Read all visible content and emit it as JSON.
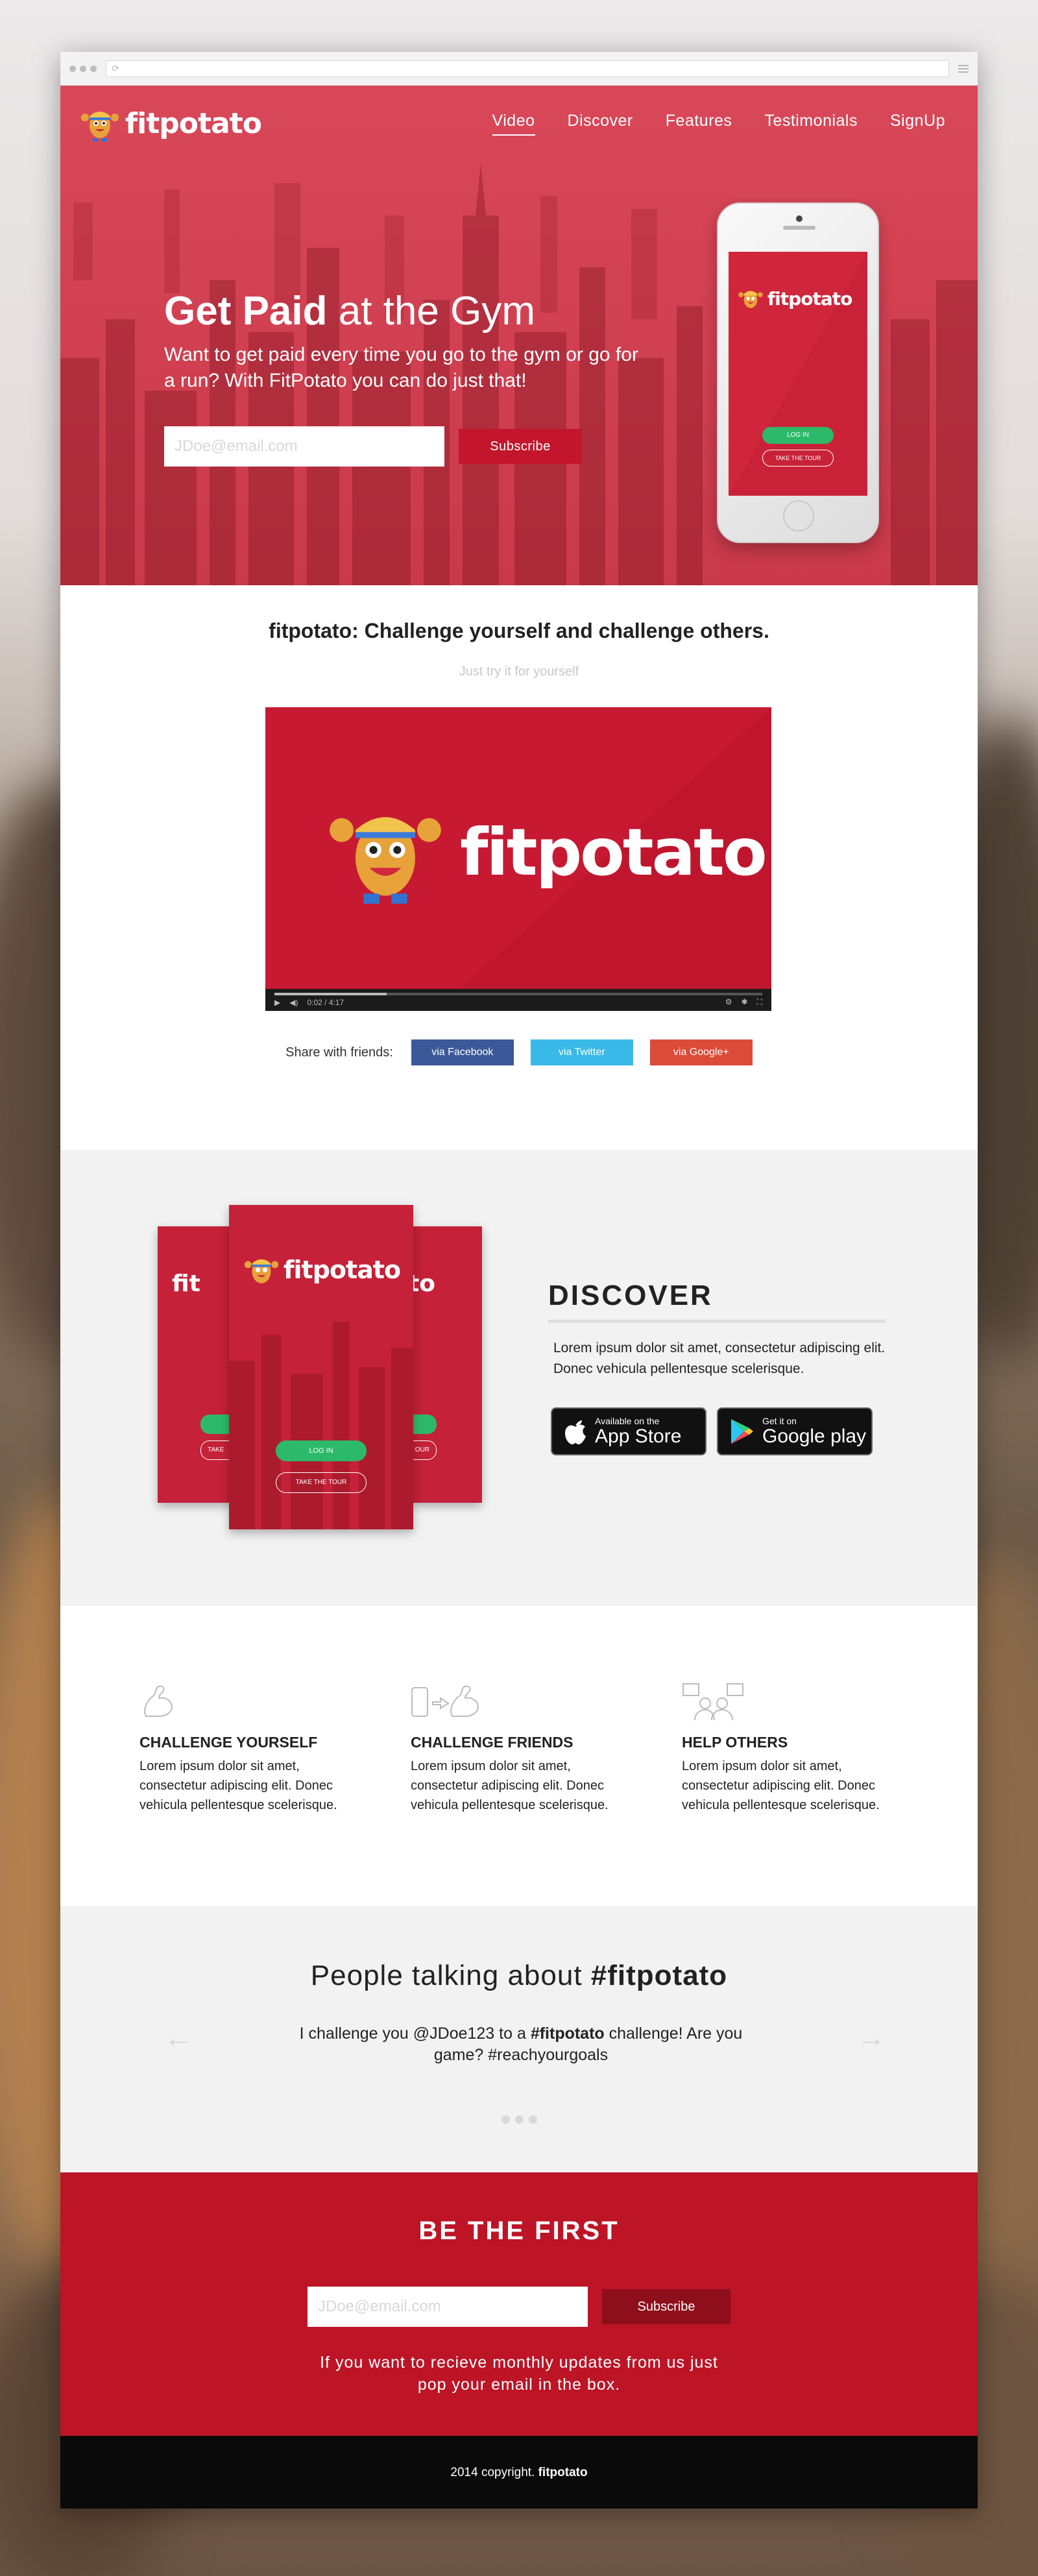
{
  "colors": {
    "brand_red": "#c3162c",
    "facebook": "#3b5998",
    "twitter": "#39b9e8",
    "google": "#dc4a38",
    "green": "#2db96a"
  },
  "browser": {
    "url": ""
  },
  "nav": {
    "brand": "fitpotato",
    "links": [
      "Video",
      "Discover",
      "Features",
      "Testimonials",
      "SignUp"
    ],
    "active": "Video"
  },
  "hero": {
    "title_bold": "Get Paid",
    "title_rest": " at the Gym",
    "subtitle": "Want to get paid every time you go to the gym or go for a run? With FitPotato you can do just that!",
    "email_placeholder": "JDoe@email.com",
    "subscribe": "Subscribe",
    "phone": {
      "brand": "fitpotato",
      "login": "LOG IN",
      "tour": "TAKE THE TOUR"
    }
  },
  "video_section": {
    "title_bold": "fitpotato:",
    "title_rest": " Challenge yourself and challenge others.",
    "subtitle": "Just try it for yourself",
    "video_brand": "fitpotato",
    "time": "0:02 / 4:17",
    "share_label": "Share with friends:",
    "share": {
      "facebook": "via Facebook",
      "twitter": "via Twitter",
      "google": "via Google+"
    }
  },
  "discover": {
    "title": "DISCOVER",
    "text": "Lorem ipsum dolor sit amet, consectetur adipiscing elit. Donec vehicula pellentesque scelerisque.",
    "card_brand": "fitpotato",
    "card_brand_short": "fit",
    "card_login": "LOG IN",
    "card_tour": "TAKE THE TOUR",
    "card_tour_short": "TAKE",
    "card_tour_end": "OUR",
    "appstore_small": "Available on the",
    "appstore_big": "App Store",
    "gplay_small": "Get it on",
    "gplay_big": "Google play"
  },
  "features": [
    {
      "title": "CHALLENGE YOURSELF",
      "text": "Lorem ipsum dolor sit amet, consectetur adipiscing elit. Donec vehicula pellentesque scelerisque.",
      "icon": "flexed-arm-icon"
    },
    {
      "title": "CHALLENGE FRIENDS",
      "text": "Lorem ipsum dolor sit amet, consectetur adipiscing elit. Donec vehicula pellentesque scelerisque.",
      "icon": "phone-arm-icon"
    },
    {
      "title": "HELP OTHERS",
      "text": "Lorem ipsum dolor sit amet, consectetur adipiscing elit. Donec vehicula pellentesque scelerisque.",
      "icon": "people-chat-icon"
    }
  ],
  "testimonials": {
    "title_rest": "People talking about ",
    "title_bold": "#fitpotato",
    "quote_a": "I challenge you @JDoe123 to a ",
    "quote_b": "#fitpotato",
    "quote_c": " challenge! Are you game? #reachyourgoals"
  },
  "befirst": {
    "title": "BE THE FIRST",
    "email_placeholder": "JDoe@email.com",
    "subscribe": "Subscribe",
    "note": "If you want to recieve monthly updates from us just pop your email in the box."
  },
  "footer": {
    "copyright": "2014 copyright. ",
    "brand": "fitpotato"
  }
}
